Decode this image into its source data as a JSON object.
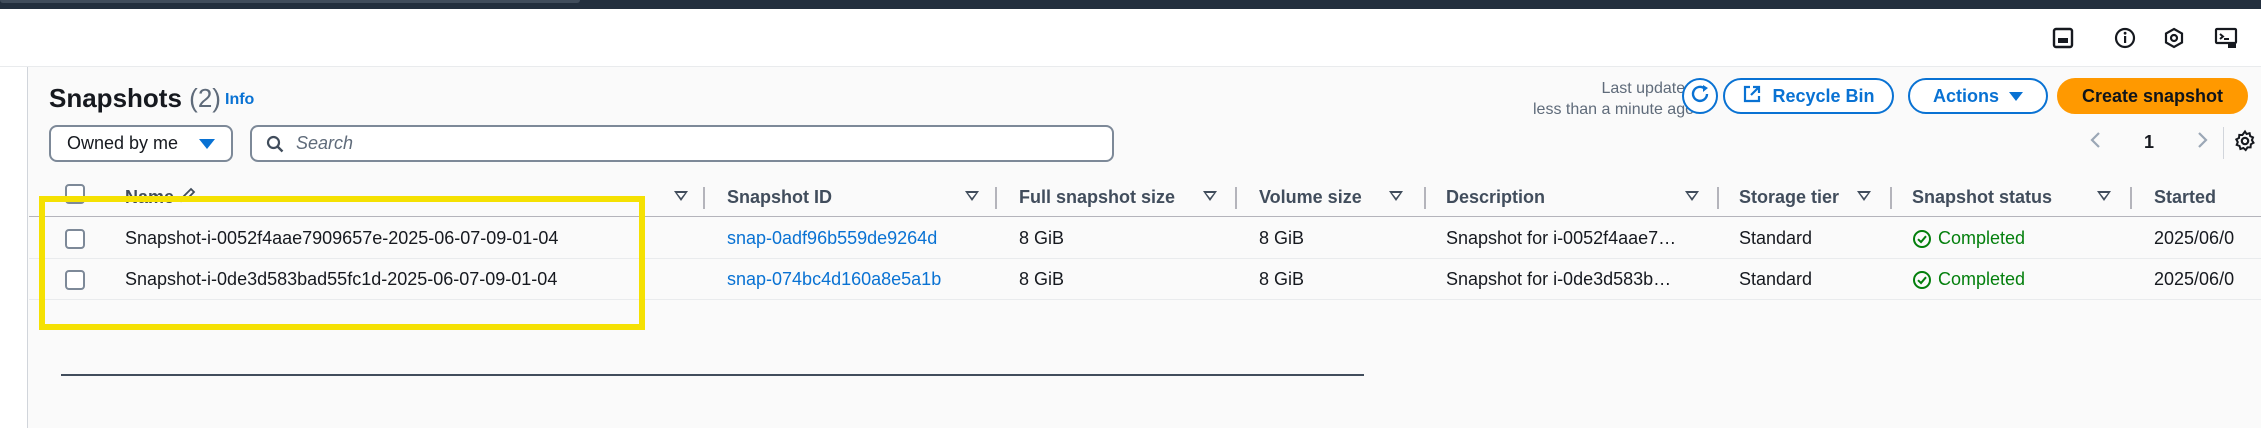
{
  "header": {
    "icons": [
      "split-panel-icon",
      "info-circle-icon",
      "hexagon-settings-icon",
      "cloudshell-icon"
    ]
  },
  "page": {
    "title": "Snapshots",
    "count": "(2)",
    "info_link": "Info",
    "last_updated_line1": "Last updated",
    "last_updated_line2": "less than a minute ago"
  },
  "toolbar": {
    "recycle_bin_label": "Recycle Bin",
    "actions_label": "Actions",
    "create_label": "Create snapshot"
  },
  "filter": {
    "owner_selected": "Owned by me",
    "search_placeholder": "Search",
    "search_value": ""
  },
  "pagination": {
    "current_page": "1"
  },
  "table": {
    "columns": [
      "Name",
      "Snapshot ID",
      "Full snapshot size",
      "Volume size",
      "Description",
      "Storage tier",
      "Snapshot status",
      "Started"
    ],
    "rows": [
      {
        "name": "Snapshot-i-0052f4aae7909657e-2025-06-07-09-01-04",
        "snapshot_id": "snap-0adf96b559de9264d",
        "full_size": "8 GiB",
        "volume_size": "8 GiB",
        "description": "Snapshot for i-0052f4aae7…",
        "storage_tier": "Standard",
        "status": "Completed",
        "started": "2025/06/0"
      },
      {
        "name": "Snapshot-i-0de3d583bad55fc1d-2025-06-07-09-01-04",
        "snapshot_id": "snap-074bc4d160a8e5a1b",
        "full_size": "8 GiB",
        "volume_size": "8 GiB",
        "description": "Snapshot for i-0de3d583b…",
        "storage_tier": "Standard",
        "status": "Completed",
        "started": "2025/06/0"
      }
    ]
  },
  "colors": {
    "link": "#0972d3",
    "primary_button": "#ff9900",
    "success": "#037f0c",
    "highlight_box": "#f5e102",
    "top_nav": "#232f3e"
  }
}
